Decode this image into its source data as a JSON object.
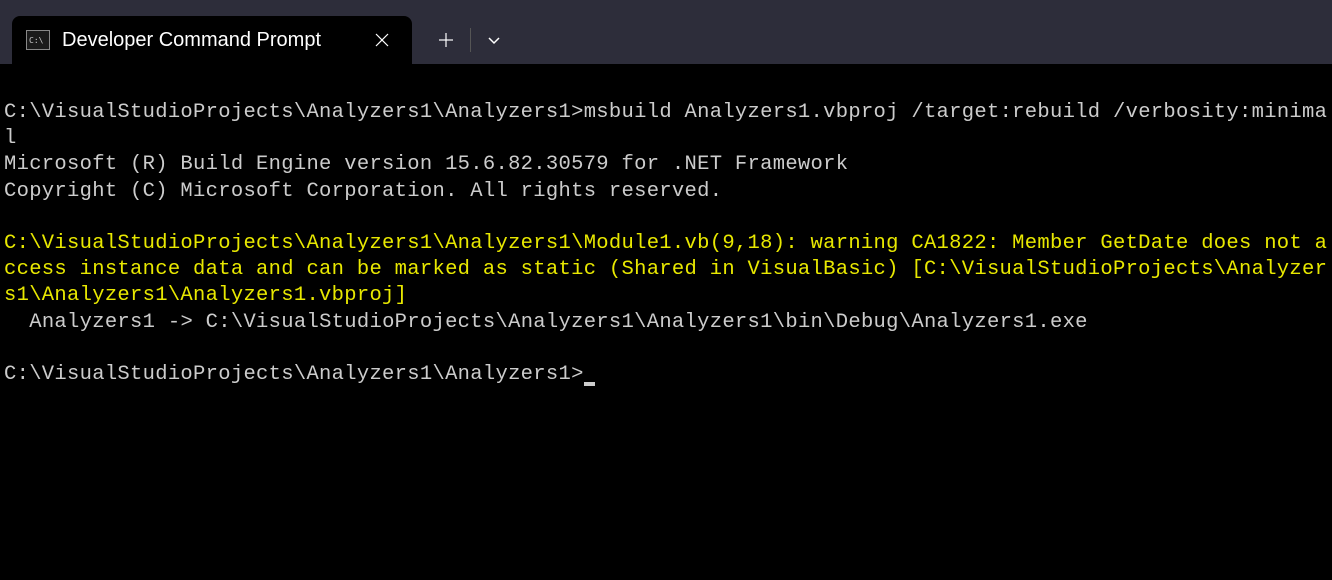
{
  "tab": {
    "title": "Developer Command Prompt"
  },
  "terminal": {
    "prompt1": "C:\\VisualStudioProjects\\Analyzers1\\Analyzers1>",
    "command1": "msbuild Analyzers1.vbproj /target:rebuild /verbosity:minimal",
    "output1": "Microsoft (R) Build Engine version 15.6.82.30579 for .NET Framework",
    "output2": "Copyright (C) Microsoft Corporation. All rights reserved.",
    "warning": "C:\\VisualStudioProjects\\Analyzers1\\Analyzers1\\Module1.vb(9,18): warning CA1822: Member GetDate does not access instance data and can be marked as static (Shared in VisualBasic) [C:\\VisualStudioProjects\\Analyzers1\\Analyzers1\\Analyzers1.vbproj]",
    "output3": "  Analyzers1 -> C:\\VisualStudioProjects\\Analyzers1\\Analyzers1\\bin\\Debug\\Analyzers1.exe",
    "prompt2": "C:\\VisualStudioProjects\\Analyzers1\\Analyzers1>"
  }
}
